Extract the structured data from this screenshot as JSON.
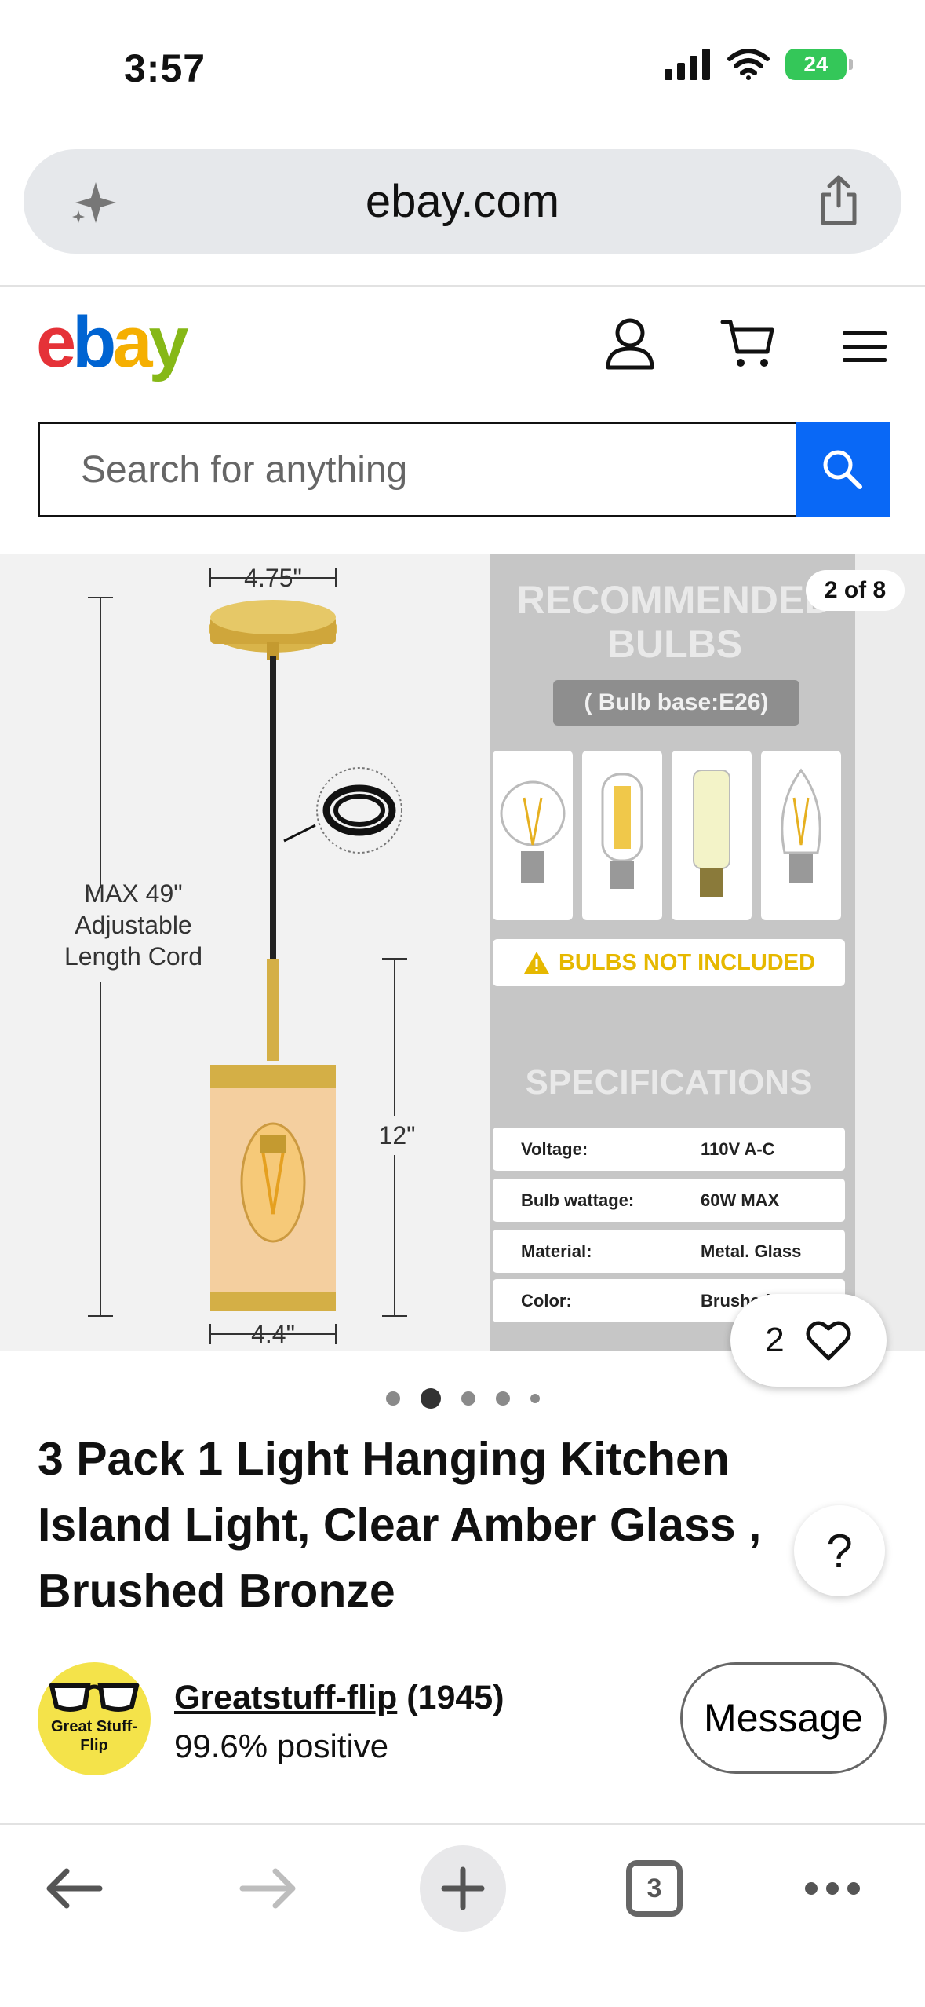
{
  "status_bar": {
    "time": "3:57",
    "battery": "24"
  },
  "browser": {
    "url": "ebay.com",
    "tabs_count": "3"
  },
  "header": {
    "logo": {
      "e": "e",
      "b": "b",
      "a": "a",
      "y": "y"
    },
    "search_placeholder": "Search for anything"
  },
  "gallery": {
    "counter": "2 of 8",
    "dim_top": "4.75\"",
    "dim_cord": "MAX 49\"\nAdjustable\nLength Cord",
    "dim_height": "12\"",
    "dim_bottom": "4.4\"",
    "recommended_title": "RECOMMENDED\nBULBS",
    "bulb_base": "( Bulb base:E26)",
    "warning": "BULBS NOT INCLUDED",
    "specs_title": "SPECIFICATIONS",
    "specs": [
      {
        "key": "Voltage:",
        "value": "110V  A-C"
      },
      {
        "key": "Bulb wattage:",
        "value": "60W MAX"
      },
      {
        "key": "Material:",
        "value": "Metal. Glass"
      },
      {
        "key": "Color:",
        "value": "Brushed"
      }
    ],
    "likes": "2",
    "active_index": 2
  },
  "listing": {
    "title": "3 Pack 1 Light Hanging Kitchen Island Light, Clear Amber Glass , Brushed Bronze",
    "help": "?"
  },
  "seller": {
    "avatar_text": "Great Stuff-\nFlip",
    "name": "Greatstuff-flip",
    "count": "(1945)",
    "feedback": "99.6% positive",
    "message_label": "Message"
  },
  "colors": {
    "ebay_red": "#e53238",
    "ebay_blue": "#0064d2",
    "ebay_yellow": "#f5af02",
    "ebay_green": "#86b817",
    "search_blue": "#0968f6",
    "battery_green": "#34c759"
  }
}
